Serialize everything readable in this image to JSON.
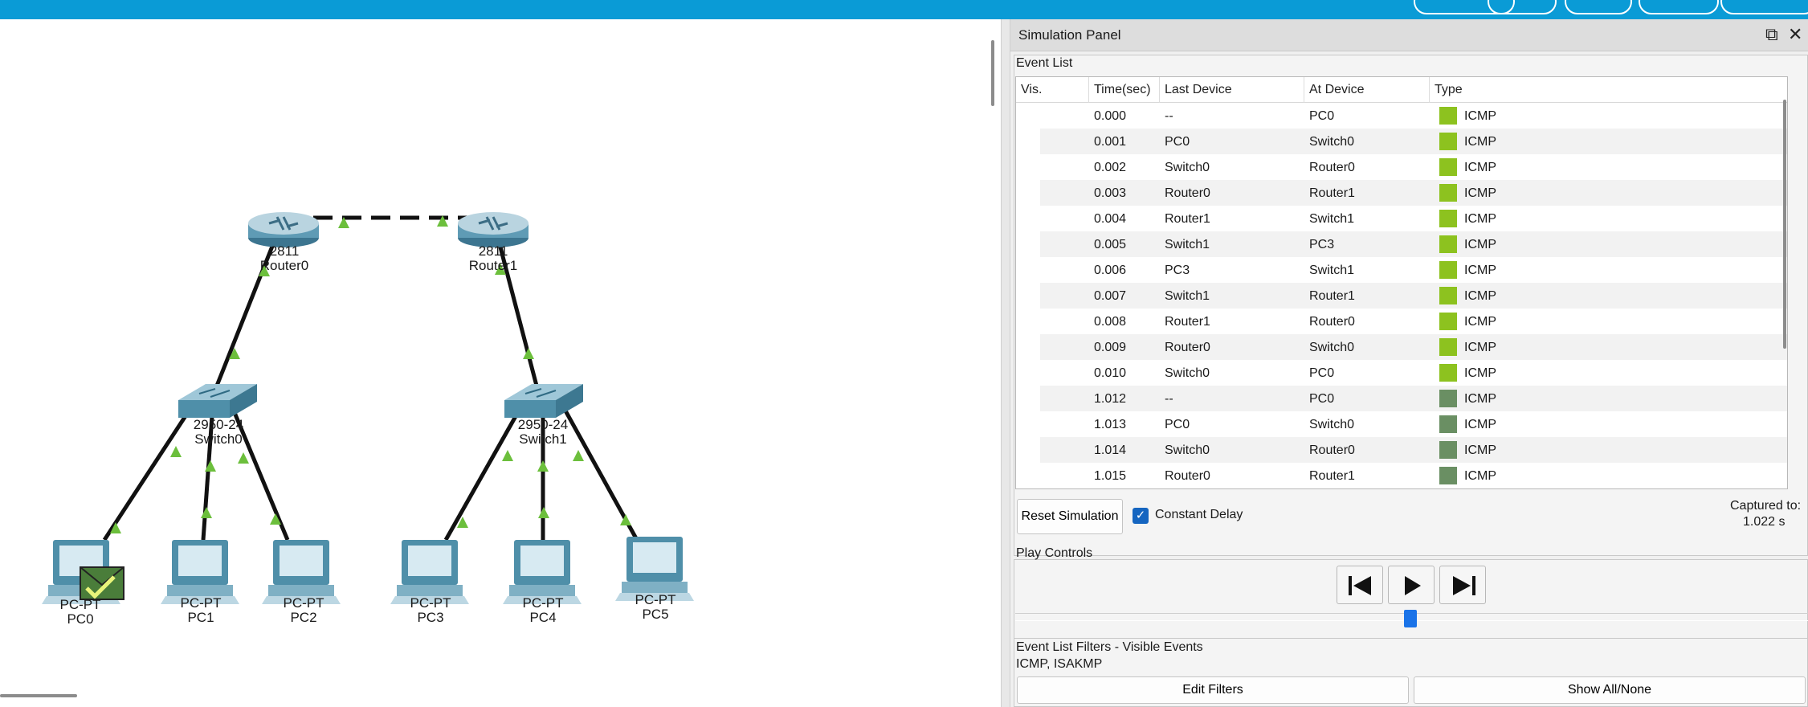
{
  "topbar": {
    "accent": "#0a9bd6"
  },
  "workspace": {
    "devices": {
      "router0": {
        "model": "2811",
        "name": "Router0"
      },
      "router1": {
        "model": "2811",
        "name": "Router1"
      },
      "switch0": {
        "model": "2950-24",
        "name": "Switch0"
      },
      "switch1": {
        "model": "2950-24",
        "name": "Switch1"
      },
      "pc0": {
        "model": "PC-PT",
        "name": "PC0"
      },
      "pc1": {
        "model": "PC-PT",
        "name": "PC1"
      },
      "pc2": {
        "model": "PC-PT",
        "name": "PC2"
      },
      "pc3": {
        "model": "PC-PT",
        "name": "PC3"
      },
      "pc4": {
        "model": "PC-PT",
        "name": "PC4"
      },
      "pc5": {
        "model": "PC-PT",
        "name": "PC5"
      }
    },
    "link_status_color": "#6cbf3c"
  },
  "panel": {
    "title": "Simulation Panel",
    "restore_icon": "restore-window-icon",
    "close_icon": "close-icon",
    "event_list": {
      "label": "Event List",
      "columns": [
        "Vis.",
        "Time(sec)",
        "Last Device",
        "At Device",
        "Type"
      ],
      "rows": [
        {
          "time": "0.000",
          "last": "--",
          "at": "PC0",
          "type": "ICMP",
          "color": "#8dc21f"
        },
        {
          "time": "0.001",
          "last": "PC0",
          "at": "Switch0",
          "type": "ICMP",
          "color": "#8dc21f"
        },
        {
          "time": "0.002",
          "last": "Switch0",
          "at": "Router0",
          "type": "ICMP",
          "color": "#8dc21f"
        },
        {
          "time": "0.003",
          "last": "Router0",
          "at": "Router1",
          "type": "ICMP",
          "color": "#8dc21f"
        },
        {
          "time": "0.004",
          "last": "Router1",
          "at": "Switch1",
          "type": "ICMP",
          "color": "#8dc21f"
        },
        {
          "time": "0.005",
          "last": "Switch1",
          "at": "PC3",
          "type": "ICMP",
          "color": "#8dc21f"
        },
        {
          "time": "0.006",
          "last": "PC3",
          "at": "Switch1",
          "type": "ICMP",
          "color": "#8dc21f"
        },
        {
          "time": "0.007",
          "last": "Switch1",
          "at": "Router1",
          "type": "ICMP",
          "color": "#8dc21f"
        },
        {
          "time": "0.008",
          "last": "Router1",
          "at": "Router0",
          "type": "ICMP",
          "color": "#8dc21f"
        },
        {
          "time": "0.009",
          "last": "Router0",
          "at": "Switch0",
          "type": "ICMP",
          "color": "#8dc21f"
        },
        {
          "time": "0.010",
          "last": "Switch0",
          "at": "PC0",
          "type": "ICMP",
          "color": "#8dc21f"
        },
        {
          "time": "1.012",
          "last": "--",
          "at": "PC0",
          "type": "ICMP",
          "color": "#6a8f63"
        },
        {
          "time": "1.013",
          "last": "PC0",
          "at": "Switch0",
          "type": "ICMP",
          "color": "#6a8f63"
        },
        {
          "time": "1.014",
          "last": "Switch0",
          "at": "Router0",
          "type": "ICMP",
          "color": "#6a8f63"
        },
        {
          "time": "1.015",
          "last": "Router0",
          "at": "Router1",
          "type": "ICMP",
          "color": "#6a8f63"
        }
      ]
    },
    "reset_label": "Reset Simulation",
    "constant_delay_label": "Constant Delay",
    "constant_delay_checked": true,
    "captured_label": "Captured to:",
    "captured_value": "1.022 s",
    "play_controls": {
      "label": "Play Controls",
      "back_icon": "skip-back-icon",
      "play_icon": "play-icon",
      "forward_icon": "skip-forward-icon"
    },
    "filters": {
      "label": "Event List Filters - Visible Events",
      "value": "ICMP, ISAKMP",
      "edit_label": "Edit Filters",
      "show_label": "Show All/None"
    }
  }
}
